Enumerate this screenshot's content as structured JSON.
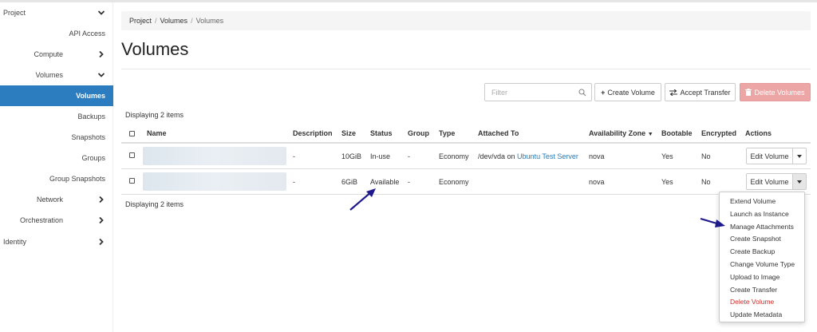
{
  "sidebar": {
    "items": [
      {
        "label": "Project",
        "chevron": "down"
      },
      {
        "label": "API Access",
        "chevron": ""
      },
      {
        "label": "Compute",
        "chevron": "right"
      },
      {
        "label": "Volumes",
        "chevron": "down"
      },
      {
        "label": "Volumes",
        "chevron": "",
        "active": true
      },
      {
        "label": "Backups",
        "chevron": ""
      },
      {
        "label": "Snapshots",
        "chevron": ""
      },
      {
        "label": "Groups",
        "chevron": ""
      },
      {
        "label": "Group Snapshots",
        "chevron": ""
      },
      {
        "label": "Network",
        "chevron": "right"
      },
      {
        "label": "Orchestration",
        "chevron": "right"
      },
      {
        "label": "Identity",
        "chevron": "right"
      }
    ],
    "active_color": "#2c7dbf"
  },
  "breadcrumb": {
    "items": [
      "Project",
      "Volumes",
      "Volumes"
    ],
    "separator": "/"
  },
  "page_title": "Volumes",
  "toolbar": {
    "filter_placeholder": "Filter",
    "create_label": "Create Volume",
    "accept_label": "Accept Transfer",
    "delete_label": "Delete Volumes",
    "delete_color": "#eda6a6"
  },
  "count_text": "Displaying 2 items",
  "table": {
    "headers": {
      "name": "Name",
      "description": "Description",
      "size": "Size",
      "status": "Status",
      "group": "Group",
      "type": "Type",
      "attached": "Attached To",
      "az": "Availability Zone",
      "bootable": "Bootable",
      "encrypted": "Encrypted",
      "actions": "Actions"
    },
    "rows": [
      {
        "description": "-",
        "size": "10GiB",
        "status": "In-use",
        "group": "-",
        "type": "Economy",
        "attached_prefix": "/dev/vda on ",
        "attached_link": "Ubuntu Test Server",
        "az": "nova",
        "bootable": "Yes",
        "encrypted": "No",
        "action": "Edit Volume"
      },
      {
        "description": "-",
        "size": "6GiB",
        "status": "Available",
        "group": "-",
        "type": "Economy",
        "attached_prefix": "",
        "attached_link": "",
        "az": "nova",
        "bootable": "Yes",
        "encrypted": "No",
        "action": "Edit Volume"
      }
    ]
  },
  "dropdown": {
    "items": [
      {
        "label": "Extend Volume"
      },
      {
        "label": "Launch as Instance"
      },
      {
        "label": "Manage Attachments"
      },
      {
        "label": "Create Snapshot"
      },
      {
        "label": "Create Backup"
      },
      {
        "label": "Change Volume Type"
      },
      {
        "label": "Upload to Image"
      },
      {
        "label": "Create Transfer"
      },
      {
        "label": "Delete Volume",
        "danger": true
      },
      {
        "label": "Update Metadata"
      }
    ]
  },
  "annotation_color": "#1f1a8c"
}
